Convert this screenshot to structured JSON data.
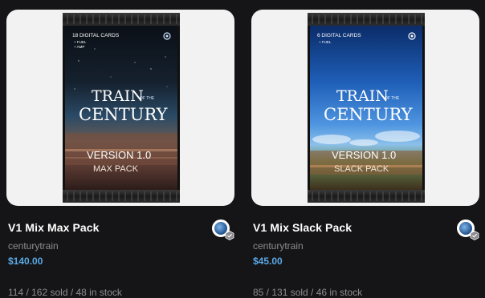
{
  "colors": {
    "background": "#151517",
    "card_image_bg": "#f2f2f2",
    "price": "#5aa9e6",
    "muted_text": "#8c8c92"
  },
  "items": [
    {
      "title": "V1 Mix Max Pack",
      "creator": "centurytrain",
      "price": "$140.00",
      "stock": "114 / 162 sold / 48 in stock",
      "pack": {
        "cards_line": "18 DIGITAL CARDS",
        "extras": [
          "+ FUEL",
          "+ AMP"
        ],
        "logo_top": "TRAIN",
        "logo_small": "OF THE",
        "logo_bottom": "CENTURY",
        "version": "VERSION 1.0",
        "pack_name": "MAX PACK"
      },
      "avatar_icon": "creator-avatar-icon",
      "verified_icon": "verified-badge-icon"
    },
    {
      "title": "V1 Mix Slack Pack",
      "creator": "centurytrain",
      "price": "$45.00",
      "stock": "85 / 131 sold / 46 in stock",
      "pack": {
        "cards_line": "6 DIGITAL CARDS",
        "extras": [
          "+ FUEL"
        ],
        "logo_top": "TRAIN",
        "logo_small": "OF THE",
        "logo_bottom": "CENTURY",
        "version": "VERSION 1.0",
        "pack_name": "SLACK PACK"
      },
      "avatar_icon": "creator-avatar-icon",
      "verified_icon": "verified-badge-icon"
    }
  ]
}
